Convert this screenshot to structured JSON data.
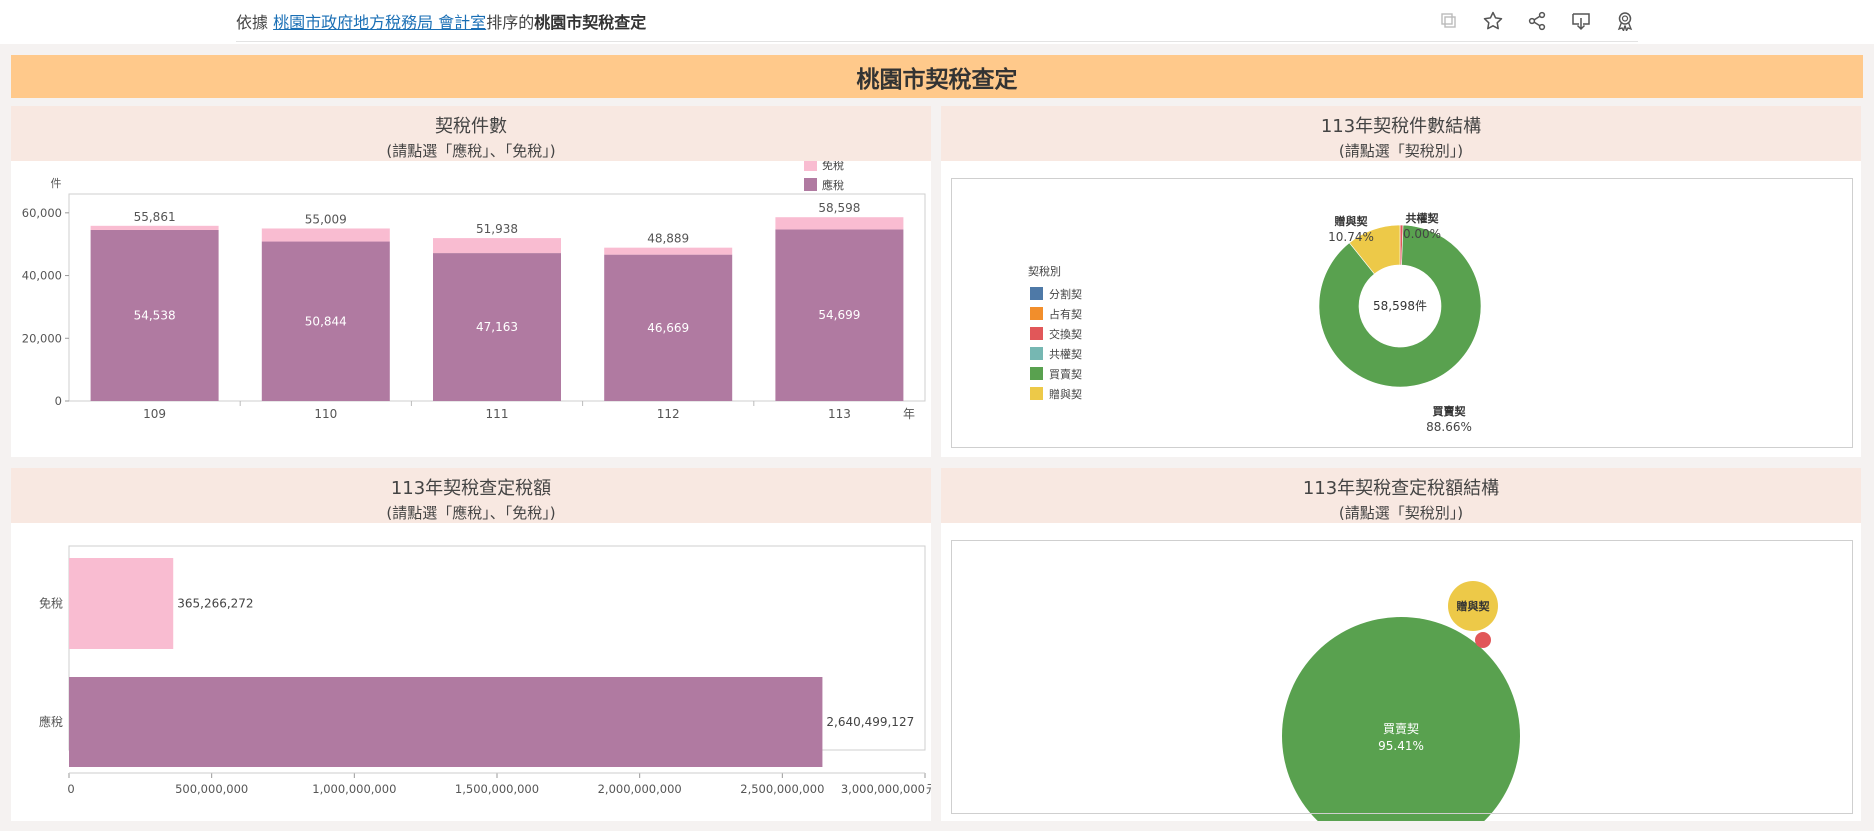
{
  "topbar": {
    "prefix": "依據 ",
    "link": "桃園市政府地方稅務局 會計室",
    "middle": "排序的",
    "title": "桃園市契稅查定",
    "icons": [
      "copy-icon",
      "star-icon",
      "share-icon",
      "download-icon",
      "award-icon"
    ]
  },
  "banner": {
    "title": "桃園市契稅查定"
  },
  "panels": {
    "p1": {
      "title": "契稅件數",
      "subtitle": "(請點選「應稅」、「免稅」)"
    },
    "p2": {
      "title": "113年契稅件數結構",
      "subtitle": "(請點選「契稅別」)"
    },
    "p3": {
      "title": "113年契稅查定稅額",
      "subtitle": "(請點選「應稅」、「免稅」)"
    },
    "p4": {
      "title": "113年契稅查定稅額結構",
      "subtitle": "(請點選「契稅別」)"
    }
  },
  "colors": {
    "taxable": "#b07aa1",
    "exempt": "#f9bcd1",
    "banner": "#ffc98b",
    "分割契": "#4e79a7",
    "占有契": "#f28e2b",
    "交換契": "#e15759",
    "共權契": "#76b7b2",
    "買賣契": "#59a14f",
    "贈與契": "#edc948"
  },
  "chart_data": [
    {
      "type": "bar",
      "stacked": true,
      "categories": [
        "109",
        "110",
        "111",
        "112",
        "113"
      ],
      "series": [
        {
          "name": "應稅",
          "values": [
            54538,
            50844,
            47163,
            46669,
            54699
          ]
        },
        {
          "name": "免稅",
          "values": [
            1323,
            4165,
            4775,
            2220,
            3899
          ]
        }
      ],
      "totals": [
        55861,
        55009,
        51938,
        48889,
        58598
      ],
      "value_labels": [
        "54,538",
        "50,844",
        "47,163",
        "46,669",
        "54,699"
      ],
      "total_labels": [
        "55,861",
        "55,009",
        "51,938",
        "48,889",
        "58,598"
      ],
      "ylabel": "件",
      "xlabel": "年",
      "ylim": [
        0,
        66000
      ],
      "yticks": [
        0,
        20000,
        40000,
        60000
      ],
      "ytick_labels": [
        "0",
        "20,000",
        "40,000",
        "60,000"
      ],
      "legend": [
        "免稅",
        "應稅"
      ],
      "legend_position": "top-right"
    },
    {
      "type": "pie",
      "donut": true,
      "center_label": "58,598件",
      "legend_title": "契稅別",
      "legend": [
        "分割契",
        "占有契",
        "交換契",
        "共權契",
        "買賣契",
        "贈與契"
      ],
      "slices": [
        {
          "name": "買賣契",
          "percent": 88.66,
          "label": "88.66%"
        },
        {
          "name": "贈與契",
          "percent": 10.74,
          "label": "10.74%"
        },
        {
          "name": "共權契",
          "percent": 0.0,
          "label": "0.00%"
        },
        {
          "name": "交換契",
          "percent": 0.6,
          "label": ""
        }
      ],
      "legend_position": "left"
    },
    {
      "type": "bar",
      "orientation": "horizontal",
      "categories": [
        "免稅",
        "應稅"
      ],
      "values": [
        365266272,
        2640499127
      ],
      "value_labels": [
        "365,266,272",
        "2,640,499,127"
      ],
      "xlabel": "元",
      "xlim": [
        0,
        3000000000
      ],
      "xticks": [
        0,
        500000000,
        1000000000,
        1500000000,
        2000000000,
        2500000000,
        3000000000
      ],
      "xtick_labels": [
        "0",
        "500,000,000",
        "1,000,000,000",
        "1,500,000,000",
        "2,000,000,000",
        "2,500,000,000",
        "3,000,000,000"
      ]
    },
    {
      "type": "bubble",
      "bubbles": [
        {
          "name": "買賣契",
          "percent": 95.41,
          "label": "95.41%"
        },
        {
          "name": "贈與契",
          "label": ""
        },
        {
          "name": "交換契",
          "label": ""
        }
      ]
    }
  ]
}
